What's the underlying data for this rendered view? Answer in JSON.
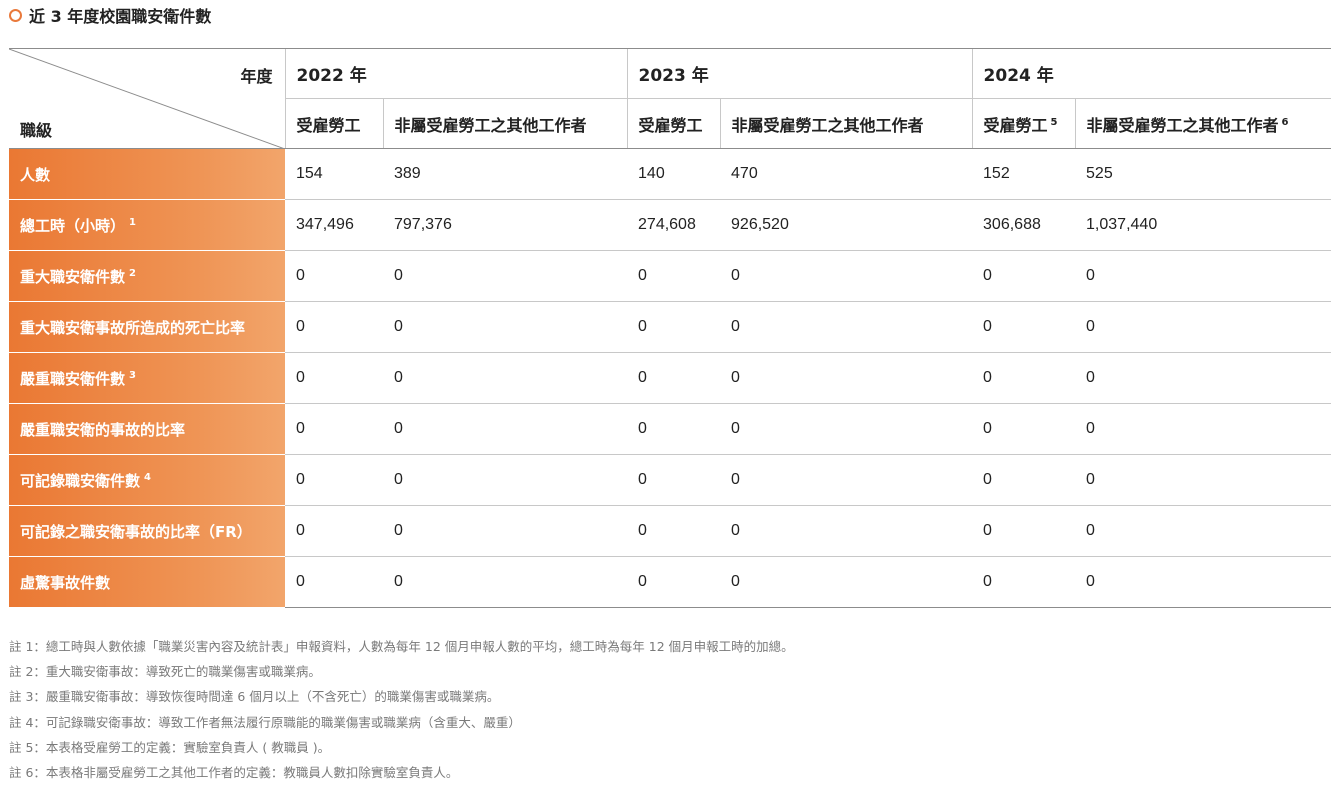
{
  "title": "近 3 年度校園職安衛件數",
  "corner": {
    "year_label": "年度",
    "grade_label": "職級"
  },
  "years": [
    {
      "label": "2022 年",
      "cols": [
        {
          "label": "受雇勞工",
          "sup": ""
        },
        {
          "label": "非屬受雇勞工之其他工作者",
          "sup": ""
        }
      ]
    },
    {
      "label": "2023 年",
      "cols": [
        {
          "label": "受雇勞工",
          "sup": ""
        },
        {
          "label": "非屬受雇勞工之其他工作者",
          "sup": ""
        }
      ]
    },
    {
      "label": "2024 年",
      "cols": [
        {
          "label": "受雇勞工",
          "sup": "5"
        },
        {
          "label": "非屬受雇勞工之其他工作者",
          "sup": "6"
        }
      ]
    }
  ],
  "rows": [
    {
      "label": "人數",
      "sup": "",
      "values": [
        "154",
        "389",
        "140",
        "470",
        "152",
        "525"
      ]
    },
    {
      "label": "總工時（小時）",
      "sup": "1",
      "values": [
        "347,496",
        "797,376",
        "274,608",
        "926,520",
        "306,688",
        "1,037,440"
      ]
    },
    {
      "label": "重大職安衛件數",
      "sup": "2",
      "values": [
        "0",
        "0",
        "0",
        "0",
        "0",
        "0"
      ]
    },
    {
      "label": "重大職安衛事故所造成的死亡比率",
      "sup": "",
      "values": [
        "0",
        "0",
        "0",
        "0",
        "0",
        "0"
      ]
    },
    {
      "label": "嚴重職安衛件數",
      "sup": "3",
      "values": [
        "0",
        "0",
        "0",
        "0",
        "0",
        "0"
      ]
    },
    {
      "label": "嚴重職安衛的事故的比率",
      "sup": "",
      "values": [
        "0",
        "0",
        "0",
        "0",
        "0",
        "0"
      ]
    },
    {
      "label": "可記錄職安衛件數",
      "sup": "4",
      "values": [
        "0",
        "0",
        "0",
        "0",
        "0",
        "0"
      ]
    },
    {
      "label": "可記錄之職安衛事故的比率（FR）",
      "sup": "",
      "values": [
        "0",
        "0",
        "0",
        "0",
        "0",
        "0"
      ]
    },
    {
      "label": "虛驚事故件數",
      "sup": "",
      "values": [
        "0",
        "0",
        "0",
        "0",
        "0",
        "0"
      ]
    }
  ],
  "notes": [
    "註 1：總工時與人數依據「職業災害內容及統計表」申報資料，人數為每年 12 個月申報人數的平均，總工時為每年 12 個月申報工時的加總。",
    "註 2：重大職安衛事故：導致死亡的職業傷害或職業病。",
    "註 3：嚴重職安衛事故：導致恢復時間達 6 個月以上（不含死亡）的職業傷害或職業病。",
    "註 4：可記錄職安衛事故：導致工作者無法履行原職能的職業傷害或職業病（含重大、嚴重）",
    "註 5：本表格受雇勞工的定義：實驗室負責人 ( 教職員 )。",
    "註 6：本表格非屬受雇勞工之其他工作者的定義：教職員人數扣除實驗室負責人。"
  ],
  "colors": {
    "accent": "#ea7833",
    "row_label_text": "#ffffff",
    "notes_text": "#7a7a7a"
  }
}
